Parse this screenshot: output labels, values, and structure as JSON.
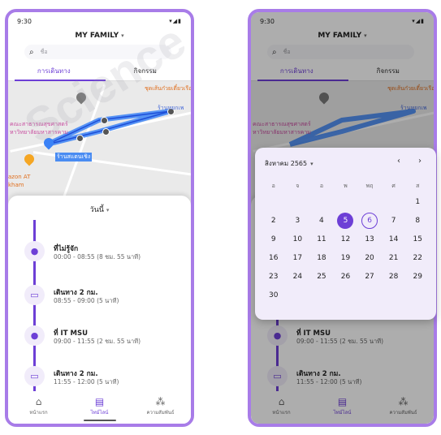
{
  "status": {
    "time": "9:30",
    "icons": "▾◢▮"
  },
  "app": {
    "title": "MY FAMILY",
    "caret": "▾",
    "search_placeholder": "ชื่อ"
  },
  "tabs": [
    {
      "label": "การเดินทาง",
      "active": true
    },
    {
      "label": "กิจกรรม",
      "active": false
    }
  ],
  "map": {
    "labels": {
      "faculty": "คณะสาธารณสุขศาสตร์",
      "university": "หาวิทยาลัยมหาสารคาม",
      "shop": "ชุดเส้นก๋วยเตี๋ยวเรือ",
      "restaurant": "ร้านหยกเพ",
      "store": "ร้านสแตนเชิง",
      "amazon": "azon AT",
      "kham": "kham"
    },
    "route_color": "#3b82f6"
  },
  "sheet": {
    "day_label": "วันนี้",
    "entries": [
      {
        "icon": "location-pin-icon",
        "glyph": "⬤",
        "title": "ที่ไม่รู้จัก",
        "sub": "00:00 - 08:55 (8 ชม. 55 นาที)"
      },
      {
        "icon": "car-icon",
        "glyph": "🚘",
        "title": "เดินทาง 2 กม.",
        "sub": "08:55 - 09:00 (5 นาที)"
      },
      {
        "icon": "location-pin-icon",
        "glyph": "⬤",
        "title": "ที่ IT MSU",
        "sub": "09:00 - 11:55 (2 ชม. 55 นาที)"
      },
      {
        "icon": "car-icon",
        "glyph": "🚘",
        "title": "เดินทาง 2 กม.",
        "sub": "11:55 - 12:00 (5 นาที)"
      }
    ]
  },
  "nav": [
    {
      "label": "หน้าแรก",
      "glyph": "⌂",
      "active": false
    },
    {
      "label": "ไทม์ไลน์",
      "glyph": "▤",
      "active": true
    },
    {
      "label": "ความสัมพันธ์",
      "glyph": "⁂",
      "active": false
    }
  ],
  "calendar": {
    "month_label": "สิงหาคม 2565",
    "caret": "▾",
    "prev": "‹",
    "next": "›",
    "weekdays": [
      "อ",
      "จ",
      "อ",
      "พ",
      "พฤ",
      "ศ",
      "ส"
    ],
    "days": [
      "1",
      "2",
      "3",
      "4",
      "5",
      "6",
      "7",
      "8",
      "9",
      "10",
      "11",
      "12",
      "13",
      "14",
      "15",
      "16",
      "17",
      "18",
      "19",
      "20",
      "21",
      "22",
      "23",
      "24",
      "25",
      "26",
      "27",
      "28",
      "29",
      "30"
    ],
    "first_day_index": 6,
    "selected": "5",
    "today": "6"
  },
  "watermark": "Science"
}
